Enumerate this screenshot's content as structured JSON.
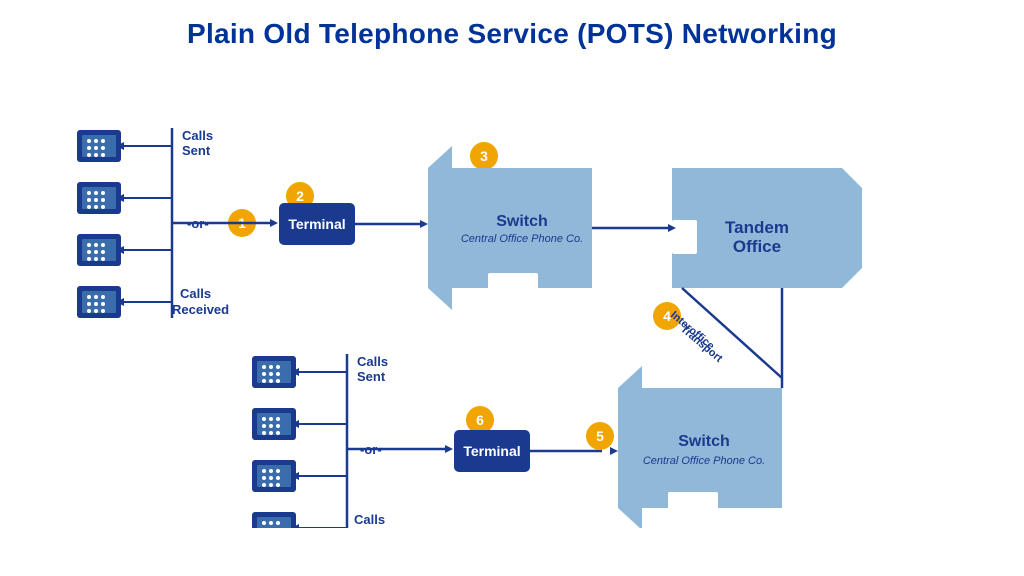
{
  "title": "Plain Old Telephone Service (POTS) Networking",
  "badges": [
    "1",
    "2",
    "3",
    "4",
    "5",
    "6"
  ],
  "labels": {
    "calls_sent": "Calls\nSent",
    "calls_received": "Calls\nReceived",
    "or": "-or-",
    "terminal": "Terminal",
    "switch_label": "Switch",
    "switch_sub": "Central Office Phone Co.",
    "tandem_label": "Tandem\nOffice",
    "interoffice": "Interoffice\nTransport"
  },
  "colors": {
    "dark_blue": "#1a3a8f",
    "light_blue": "#90b8d8",
    "mid_blue": "#5b9fc9",
    "gold": "#f0a500",
    "white": "#ffffff"
  }
}
